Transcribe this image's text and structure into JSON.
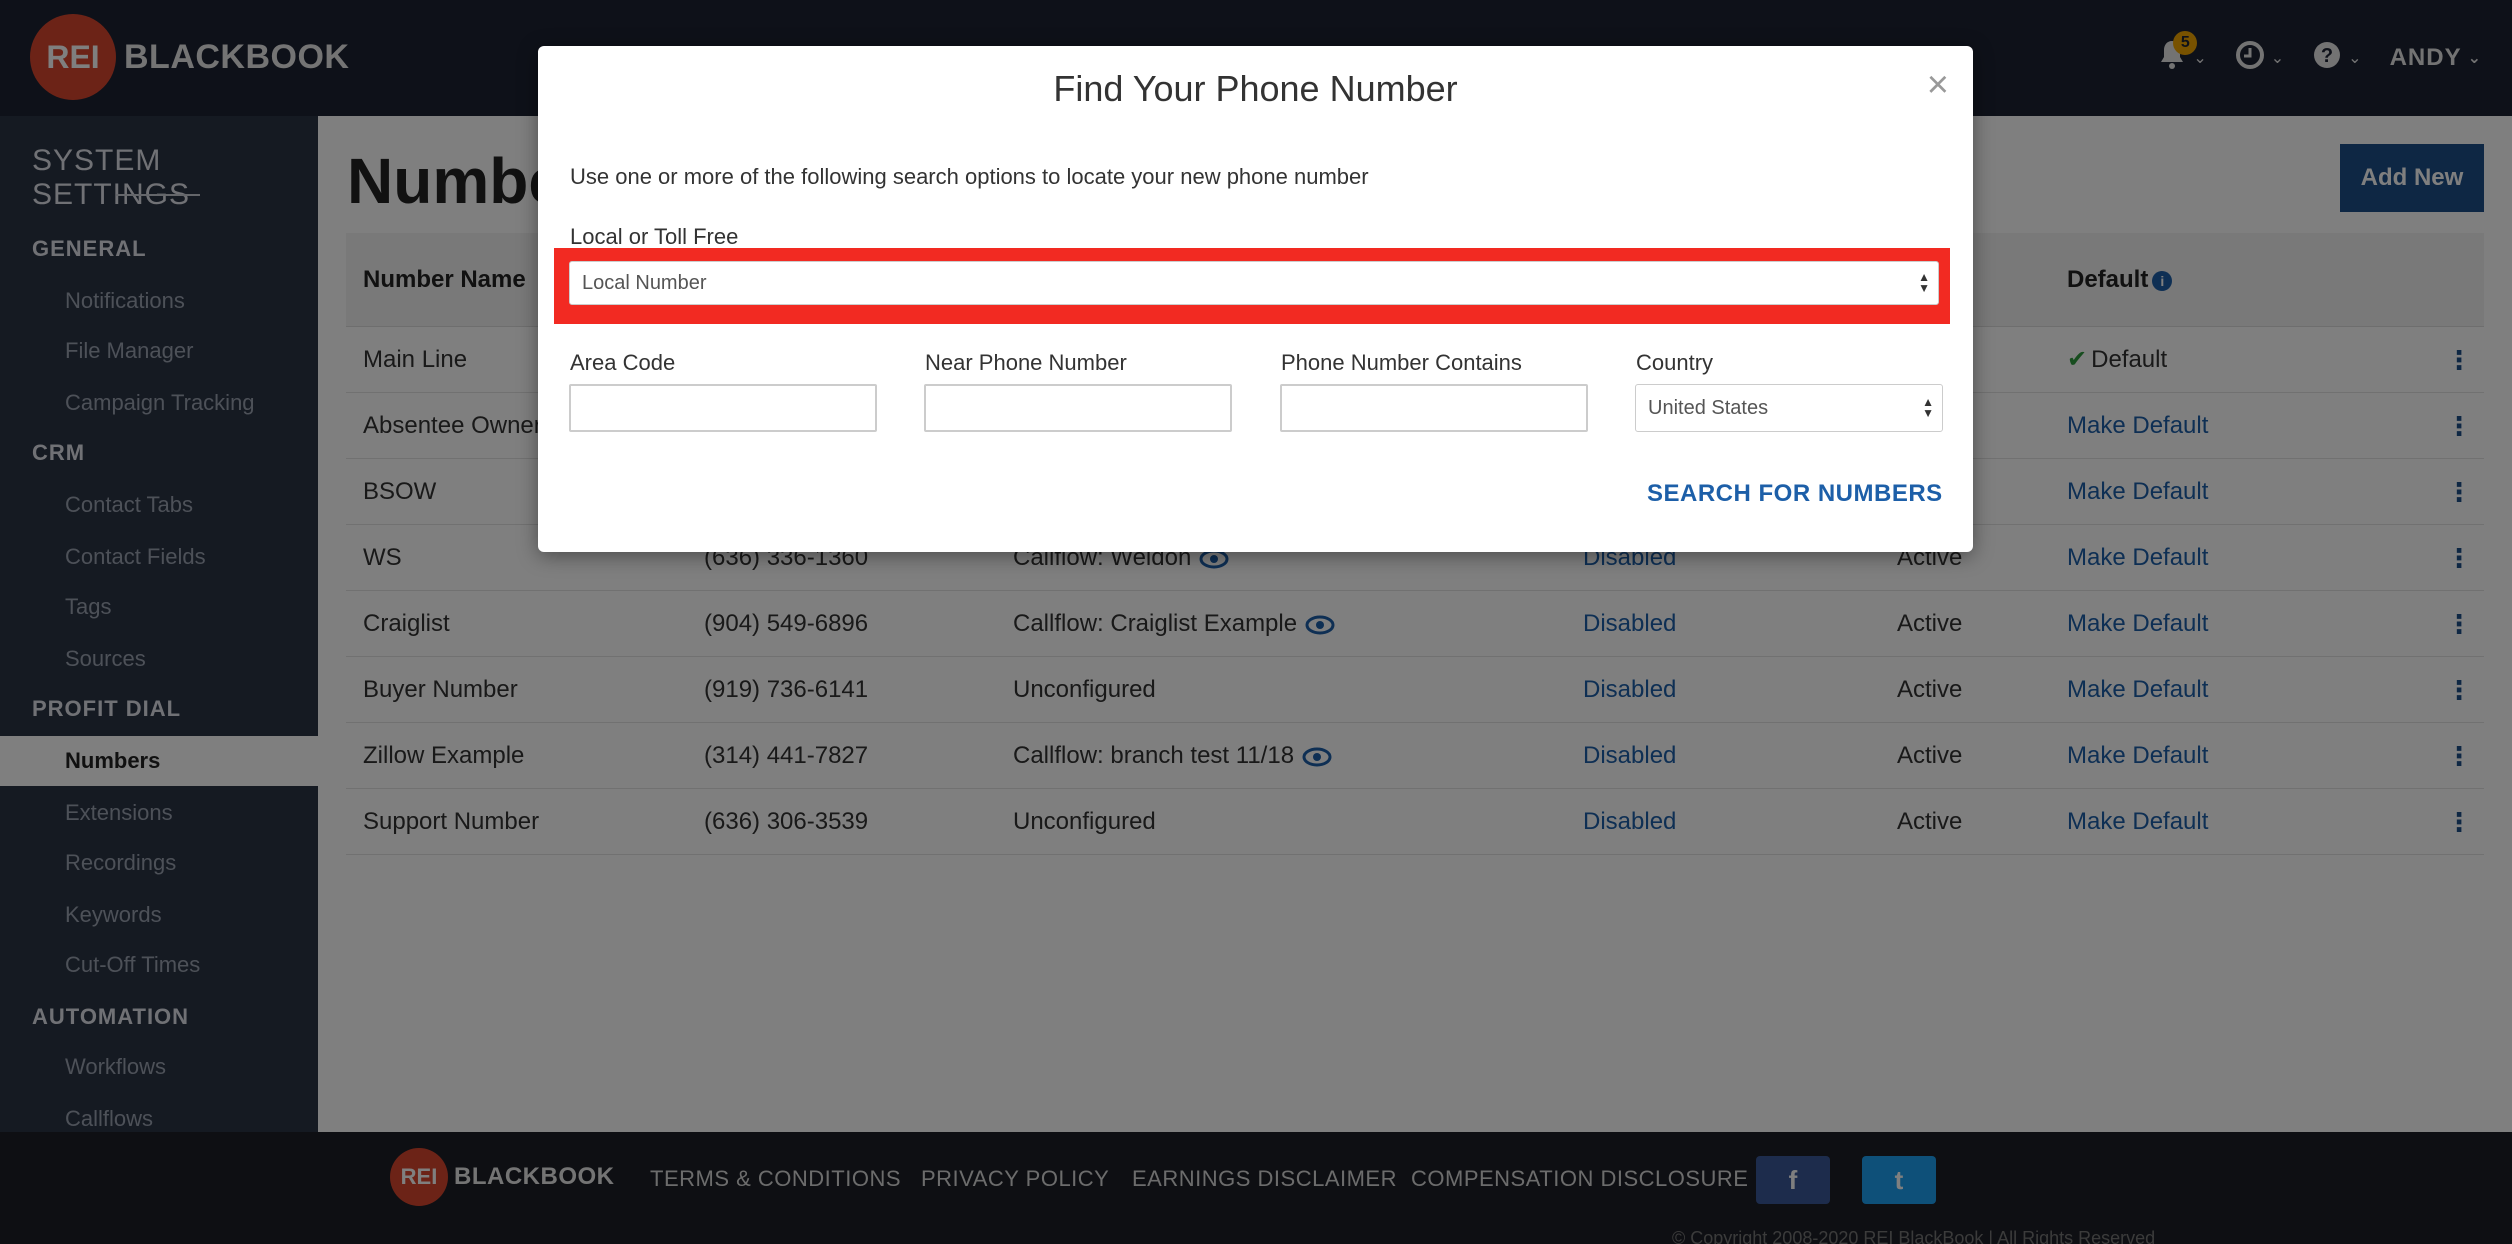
{
  "brand": {
    "logo_mark": "REI",
    "logo_text": "BLACKBOOK"
  },
  "topbar": {
    "notification_count": "5",
    "user_name": "ANDY",
    "icons": [
      "bell-icon",
      "clock-icon",
      "help-icon"
    ]
  },
  "sidebar": {
    "title": "SYSTEM SETTINGS",
    "sections": [
      {
        "label": "GENERAL",
        "items": [
          "Notifications",
          "File Manager",
          "Campaign Tracking"
        ]
      },
      {
        "label": "CRM",
        "items": [
          "Contact Tabs",
          "Contact Fields",
          "Tags",
          "Sources"
        ]
      },
      {
        "label": "PROFIT DIAL",
        "items": [
          "Numbers",
          "Extensions",
          "Recordings",
          "Keywords",
          "Cut-Off Times"
        ]
      },
      {
        "label": "AUTOMATION",
        "items": [
          "Workflows",
          "Callflows"
        ]
      }
    ],
    "active_item": "Numbers"
  },
  "main": {
    "page_title": "Numbers",
    "add_new_label": "Add New",
    "columns": {
      "name": "Number Name",
      "default": "Default"
    },
    "rows": [
      {
        "name": "Main Line",
        "number": "",
        "callflow": "",
        "status": "",
        "state": "",
        "default": "Default",
        "is_default": true
      },
      {
        "name": "Absentee Owner",
        "number": "",
        "callflow": "",
        "status": "",
        "state": "",
        "default": "Make Default"
      },
      {
        "name": "BSOW",
        "number": "",
        "callflow": "",
        "status": "",
        "state": "",
        "default": "Make Default"
      },
      {
        "name": "WS",
        "number": "(636) 336-1360",
        "callflow": "Callflow: Weldon",
        "has_eye": true,
        "status": "Disabled",
        "state": "Active",
        "default": "Make Default"
      },
      {
        "name": "Craiglist",
        "number": "(904) 549-6896",
        "callflow": "Callflow: Craiglist Example",
        "has_eye": true,
        "status": "Disabled",
        "state": "Active",
        "default": "Make Default"
      },
      {
        "name": "Buyer Number",
        "number": "(919) 736-6141",
        "callflow": "Unconfigured",
        "status": "Disabled",
        "state": "Active",
        "default": "Make Default"
      },
      {
        "name": "Zillow Example",
        "number": "(314) 441-7827",
        "callflow": "Callflow: branch test 11/18",
        "has_eye": true,
        "status": "Disabled",
        "state": "Active",
        "default": "Make Default"
      },
      {
        "name": "Support Number",
        "number": "(636) 306-3539",
        "callflow": "Unconfigured",
        "status": "Disabled",
        "state": "Active",
        "default": "Make Default"
      }
    ]
  },
  "modal": {
    "title": "Find Your Phone Number",
    "close_glyph": "×",
    "description": "Use one or more of the following search options to locate your new phone number",
    "type_label": "Local or Toll Free",
    "type_value": "Local Number",
    "area_code_label": "Area Code",
    "area_code_value": "",
    "near_label": "Near Phone Number",
    "near_value": "",
    "contains_label": "Phone Number Contains",
    "contains_value": "",
    "country_label": "Country",
    "country_value": "United States",
    "search_label": "SEARCH FOR NUMBERS"
  },
  "footer": {
    "links": [
      "TERMS & CONDITIONS",
      "PRIVACY POLICY",
      "EARNINGS DISCLAIMER",
      "COMPENSATION DISCLOSURE"
    ],
    "social": [
      {
        "name": "facebook-icon",
        "glyph": "f",
        "color": "#3b5998"
      },
      {
        "name": "twitter-icon",
        "glyph": "t",
        "color": "#1da1f2"
      }
    ],
    "copyright": "© Copyright 2008-2020 REI BlackBook | All Rights Reserved"
  },
  "colors": {
    "accent": "#1d4e89",
    "link": "#1d5fa8",
    "highlight": "#f22a22",
    "topbar": "#1c2333",
    "sidebar": "#2b3445"
  }
}
